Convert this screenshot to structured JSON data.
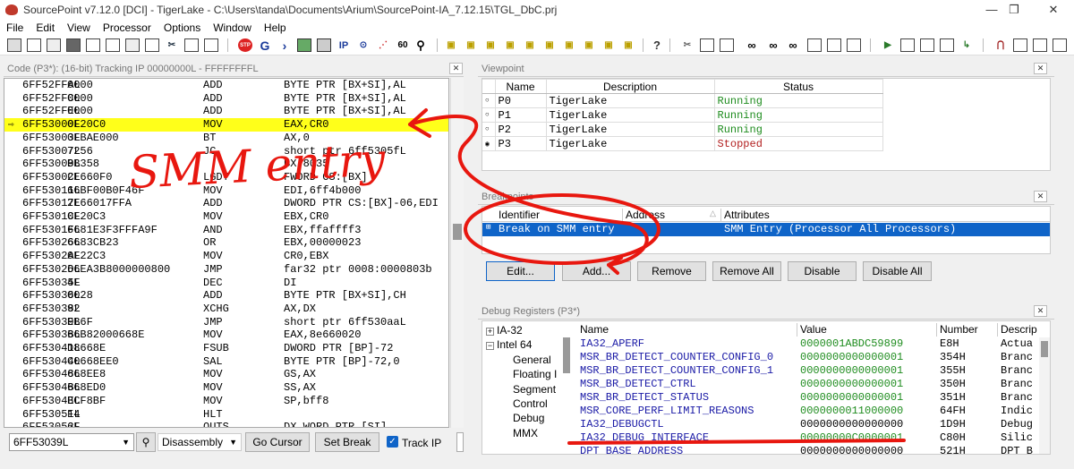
{
  "window": {
    "title": "SourcePoint v7.12.0 [DCI] - TigerLake - C:\\Users\\tanda\\Documents\\Arium\\SourcePoint-IA_7.12.15\\TGL_DbC.prj",
    "min_glyph": "—",
    "max_glyph": "❐",
    "close_glyph": "✕"
  },
  "menu": [
    "File",
    "Edit",
    "View",
    "Processor",
    "Options",
    "Window",
    "Help"
  ],
  "toolbar": {
    "ip_label": "IP"
  },
  "code_panel": {
    "title": "Code (P3*): (16-bit) Tracking IP 00000000L - FFFFFFFFL",
    "rows": [
      {
        "addr": "6FF52FFAL",
        "bytes": "0000",
        "mnemonic": "ADD",
        "operands": "BYTE PTR [BX+SI],AL"
      },
      {
        "addr": "6FF52FFCL",
        "bytes": "0000",
        "mnemonic": "ADD",
        "operands": "BYTE PTR [BX+SI],AL"
      },
      {
        "addr": "6FF52FFEL",
        "bytes": "0000",
        "mnemonic": "ADD",
        "operands": "BYTE PTR [BX+SI],AL"
      },
      {
        "addr": "6FF53000L",
        "bytes": "0F20C0",
        "mnemonic": "MOV",
        "operands": "EAX,CR0"
      },
      {
        "addr": "6FF53003L",
        "bytes": "0FBAE000",
        "mnemonic": "BT",
        "operands": "AX,0"
      },
      {
        "addr": "6FF53007L",
        "bytes": "7256",
        "mnemonic": "JC",
        "operands": "short ptr 6ff5305fL"
      },
      {
        "addr": "6FF53009L",
        "bytes": "BB358",
        "mnemonic": "",
        "operands": "BX,8035"
      },
      {
        "addr": "6FF5300CL",
        "bytes": "2E660F0",
        "mnemonic": "LGDT",
        "operands": "FWORD CS:[BX]"
      },
      {
        "addr": "6FF53011L",
        "bytes": "66BF00B0F46F",
        "mnemonic": "MOV",
        "operands": "EDI,6ff4b000"
      },
      {
        "addr": "6FF53017L",
        "bytes": "2E66017FFA",
        "mnemonic": "ADD",
        "operands": "DWORD PTR CS:[BX]-06,EDI"
      },
      {
        "addr": "6FF5301CL",
        "bytes": "0F20C3",
        "mnemonic": "MOV",
        "operands": "EBX,CR0"
      },
      {
        "addr": "6FF5301FL",
        "bytes": "6681E3F3FFFA9F",
        "mnemonic": "AND",
        "operands": "EBX,ffaffff3"
      },
      {
        "addr": "6FF53026L",
        "bytes": "6683CB23",
        "mnemonic": "OR",
        "operands": "EBX,00000023"
      },
      {
        "addr": "6FF5302AL",
        "bytes": "0F22C3",
        "mnemonic": "MOV",
        "operands": "CR0,EBX"
      },
      {
        "addr": "6FF5302DL",
        "bytes": "66EA3B8000000800",
        "mnemonic": "JMP",
        "operands": "far32 ptr 0008:0000803b"
      },
      {
        "addr": "6FF53035L",
        "bytes": "4F",
        "mnemonic": "DEC",
        "operands": "DI"
      },
      {
        "addr": "6FF53036L",
        "bytes": "0028",
        "mnemonic": "ADD",
        "operands": "BYTE PTR [BX+SI],CH"
      },
      {
        "addr": "6FF53038L",
        "bytes": "92",
        "mnemonic": "XCHG",
        "operands": "AX,DX"
      },
      {
        "addr": "6FF53039L",
        "bytes": "EB6F",
        "mnemonic": "JMP",
        "operands": "short ptr 6ff530aaL"
      },
      {
        "addr": "6FF5303BL",
        "bytes": "66B82000668E",
        "mnemonic": "MOV",
        "operands": "EAX,8e660020"
      },
      {
        "addr": "6FF53041L",
        "bytes": "D8668E",
        "mnemonic": "FSUB",
        "operands": "DWORD PTR [BP]-72"
      },
      {
        "addr": "6FF53044L",
        "bytes": "C0668EE0",
        "mnemonic": "SAL",
        "operands": "BYTE PTR [BP]-72,0"
      },
      {
        "addr": "6FF53048L",
        "bytes": "668EE8",
        "mnemonic": "MOV",
        "operands": "GS,AX"
      },
      {
        "addr": "6FF5304BL",
        "bytes": "668ED0",
        "mnemonic": "MOV",
        "operands": "SS,AX"
      },
      {
        "addr": "6FF5304EL",
        "bytes": "BCF8BF",
        "mnemonic": "MOV",
        "operands": "SP,bff8"
      },
      {
        "addr": "6FF53051L",
        "bytes": "F4",
        "mnemonic": "HLT",
        "operands": ""
      },
      {
        "addr": "6FF53052L",
        "bytes": "6F",
        "mnemonic": "OUTS",
        "operands": "DX,WORD PTR [SI]"
      },
      {
        "addr": "6FF53053L",
        "bytes": "B83580",
        "mnemonic": "MOV",
        "operands": "AX,8035"
      }
    ],
    "address_value": "6FF53039L",
    "mode_value": "Disassembly",
    "go_cursor_label": "Go Cursor",
    "set_break_label": "Set Break",
    "track_ip_label": "Track IP"
  },
  "viewpoint": {
    "title": "Viewpoint",
    "columns": [
      "Name",
      "Description",
      "Status"
    ],
    "rows": [
      {
        "name": "P0",
        "description": "TigerLake",
        "status": "Running",
        "status_color": "#1e8c1e"
      },
      {
        "name": "P1",
        "description": "TigerLake",
        "status": "Running",
        "status_color": "#1e8c1e"
      },
      {
        "name": "P2",
        "description": "TigerLake",
        "status": "Running",
        "status_color": "#1e8c1e"
      },
      {
        "name": "P3",
        "description": "TigerLake",
        "status": "Stopped",
        "status_color": "#b21f1f"
      }
    ]
  },
  "breakpoints": {
    "title": "Breakpoints",
    "columns": [
      "Identifier",
      "Address",
      "Attributes"
    ],
    "rows": [
      {
        "identifier": "Break on SMM entry",
        "address": "",
        "attributes": "SMM Entry (Processor All Processors)"
      }
    ],
    "buttons": [
      "Edit...",
      "Add...",
      "Remove",
      "Remove All",
      "Disable",
      "Disable All"
    ]
  },
  "debug_registers": {
    "title": "Debug Registers (P3*)",
    "tree": [
      {
        "label": "IA-32",
        "expander": "+"
      },
      {
        "label": "Intel 64",
        "expander": "−"
      },
      {
        "label": "General"
      },
      {
        "label": "Floating I"
      },
      {
        "label": "Segment"
      },
      {
        "label": "Control"
      },
      {
        "label": "Debug"
      },
      {
        "label": "MMX"
      }
    ],
    "columns": [
      "Name",
      "Value",
      "Number",
      "Descrip"
    ],
    "rows": [
      {
        "name": "IA32_APERF",
        "value": "0000001ABDC59899",
        "number": "E8H",
        "desc": "Actua"
      },
      {
        "name": "MSR_BR_DETECT_COUNTER_CONFIG_0",
        "value": "0000000000000001",
        "number": "354H",
        "desc": "Branc"
      },
      {
        "name": "MSR_BR_DETECT_COUNTER_CONFIG_1",
        "value": "0000000000000001",
        "number": "355H",
        "desc": "Branc"
      },
      {
        "name": "MSR_BR_DETECT_CTRL",
        "value": "0000000000000001",
        "number": "350H",
        "desc": "Branc"
      },
      {
        "name": "MSR_BR_DETECT_STATUS",
        "value": "0000000000000001",
        "number": "351H",
        "desc": "Branc"
      },
      {
        "name": "MSR_CORE_PERF_LIMIT_REASONS",
        "value": "0000000011000000",
        "number": "64FH",
        "desc": "Indic"
      },
      {
        "name": "IA32_DEBUGCTL",
        "value": "0000000000000000",
        "number": "1D9H",
        "desc": "Debug"
      },
      {
        "name": "IA32_DEBUG_INTERFACE",
        "value": "00000000C0000001",
        "number": "C80H",
        "desc": "Silic"
      },
      {
        "name": "DPT_BASE_ADDRESS",
        "value": "0000000000000000",
        "number": "521H",
        "desc": "DPT B"
      }
    ]
  },
  "annotation": {
    "handwritten_text": "SMM entry",
    "color": "#e8170f"
  }
}
